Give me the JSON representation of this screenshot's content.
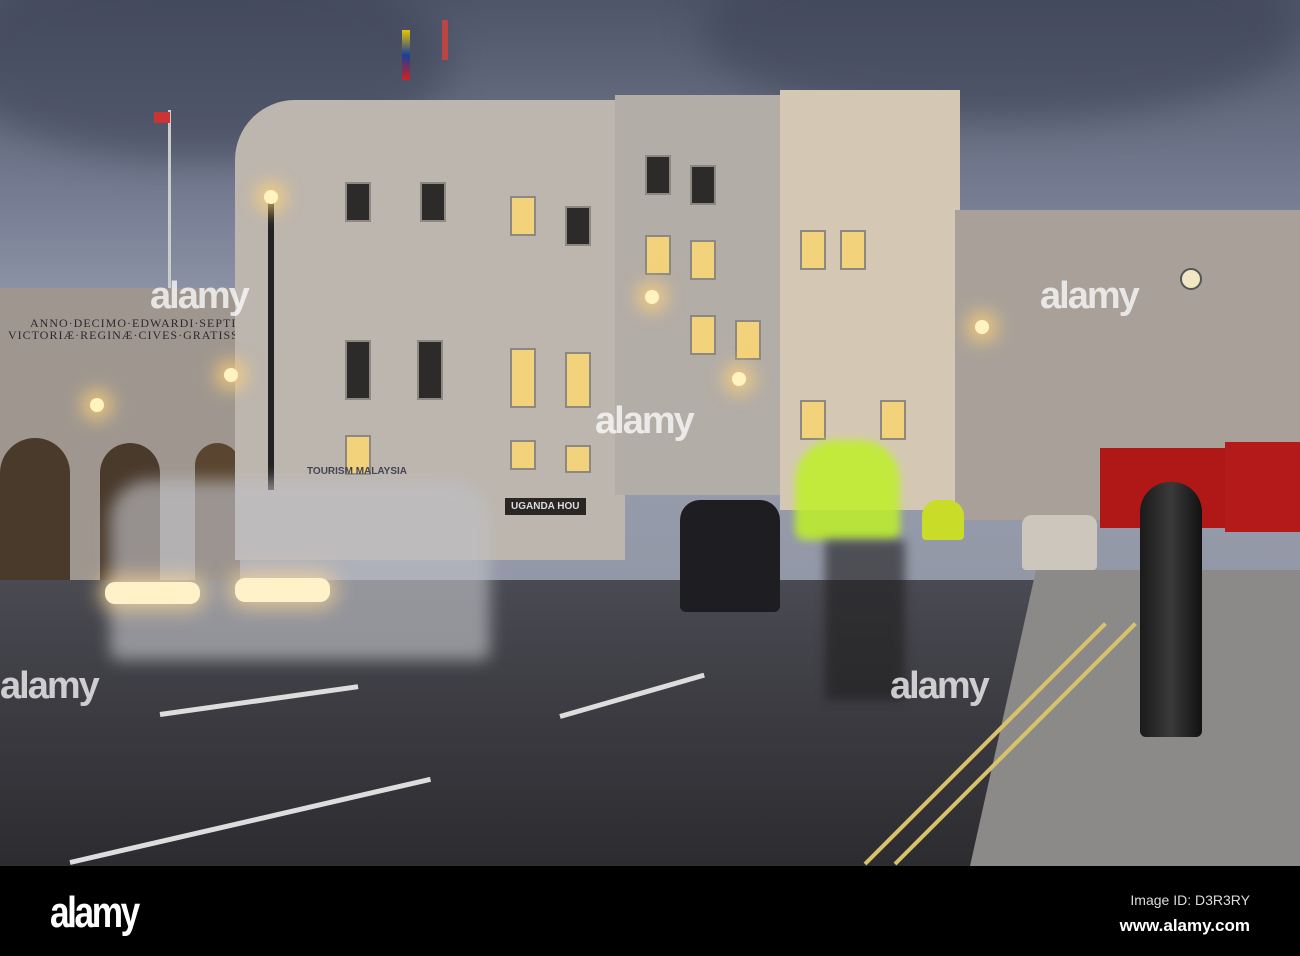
{
  "inscription": {
    "line1": "ANNO·DECIMO·EDWARDI·SEPTIMI·REGIS",
    "line2": "VICTORIÆ·REGINÆ·CIVES·GRATISSIMI·MDCC"
  },
  "signs": {
    "tourism": "TOURISM MALAYSIA",
    "uganda": "UGANDA HOU"
  },
  "watermark": "alamy",
  "footer": {
    "logo": "alamy",
    "image_id": "Image ID: D3R3RY",
    "url": "www.alamy.com"
  }
}
